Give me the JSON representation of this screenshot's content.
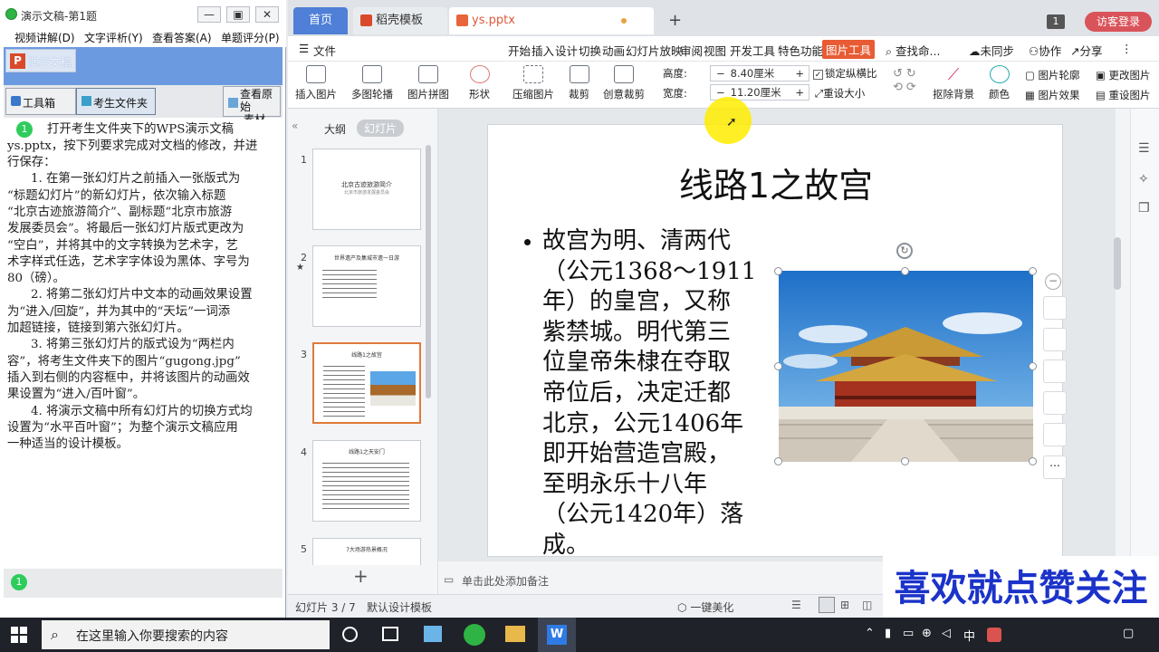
{
  "exam": {
    "title": "演示文稿-第1题",
    "menu": [
      "视频讲解(D)",
      "文字评析(Y)",
      "查看答案(A)",
      "单题评分(P)"
    ],
    "brand_label": "演示文稿",
    "brand_logo": "P",
    "tools": {
      "toolbox": "工具箱",
      "student_folder": "考生文件夹",
      "view_original_1": "查看原始",
      "view_original_2": "素材"
    },
    "step_number": "1",
    "instructions": [
      "打开考生文件夹下的WPS演示文稿",
      "ys.pptx，按下列要求完成对文档的修改，并进",
      "行保存：",
      "1. 在第一张幻灯片之前插入一张版式为",
      "“标题幻灯片”的新幻灯片，依次输入标题",
      "“北京古迹旅游简介”、副标题“北京市旅游",
      "发展委员会”。将最后一张幻灯片版式更改为",
      "“空白”，并将其中的文字转换为艺术字，艺",
      "术字样式任选，艺术字字体设为黑体、字号为",
      "80（磅）。",
      "2. 将第二张幻灯片中文本的动画效果设置",
      "为“进入/回旋”，并为其中的“天坛”一词添",
      "加超链接，链接到第六张幻灯片。",
      "3. 将第三张幻灯片的版式设为“两栏内",
      "容”，将考生文件夹下的图片“gugong.jpg”",
      "插入到右侧的内容框中，并将该图片的动画效",
      "果设置为“进入/百叶窗”。",
      "4. 将演示文稿中所有幻灯片的切换方式均",
      "设置为“水平百叶窗”；为整个演示文稿应用",
      "一种适当的设计模板。"
    ],
    "bottom_number": "1"
  },
  "wps": {
    "tabs": {
      "home": "首页",
      "template": "稻壳模板",
      "file": "ys.pptx"
    },
    "window_count": "1",
    "visitor": "访客登录",
    "ribbon_tabs": [
      "文件",
      "开始",
      "插入",
      "设计",
      "切换",
      "动画",
      "幻灯片放映",
      "审阅",
      "视图",
      "开发工具",
      "特色功能",
      "图片工具"
    ],
    "search": "查找命...",
    "sync": "未同步",
    "collab": "协作",
    "share": "分享",
    "ribbon_buttons": [
      "插入图片",
      "多图轮播",
      "图片拼图",
      "形状",
      "压缩图片",
      "裁剪",
      "创意裁剪",
      "抠除背景",
      "颜色"
    ],
    "size": {
      "height_label": "高度:",
      "height_value": "8.40厘米",
      "width_label": "宽度:",
      "width_value": "11.20厘米",
      "lock_ratio": "锁定纵横比",
      "reset_size": "重设大小"
    },
    "right_buttons": [
      "图片轮廓",
      "更改图片",
      "图片效果",
      "重设图片"
    ],
    "panel_tabs": {
      "outline": "大纲",
      "slides": "幻灯片"
    },
    "thumbs": [
      {
        "num": "1",
        "title": "北京古迹旅游简介",
        "sub": "北京市旅游发展委员会"
      },
      {
        "num": "2",
        "title": "世界遗产及集城市遗一日游"
      },
      {
        "num": "3",
        "title": "线路1之故宫"
      },
      {
        "num": "4",
        "title": "线路1之天安门"
      },
      {
        "num": "5",
        "title": "7大场游热景概况"
      }
    ],
    "slide": {
      "title": "线路1之故宫",
      "body": [
        "故宫为明、清两代",
        "（公元1368～1911",
        "年）的皇宫，又称",
        "紫禁城。明代第三",
        "位皇帝朱棣在夺取",
        "帝位后，决定迁都",
        "北京，公元1406年",
        "即开始营造宫殿，",
        "至明永乐十八年",
        "（公元1420年）落",
        "成。"
      ]
    },
    "notes": "单击此处添加备注",
    "status": {
      "slide_pos": "幻灯片 3 / 7",
      "template": "默认设计模板",
      "beautify": "一键美化"
    }
  },
  "taskbar": {
    "search_placeholder": "在这里输入你要搜索的内容",
    "ime": "中",
    "wps_label": "W"
  },
  "overlay": {
    "promo": "喜欢就点赞关注"
  },
  "colors": {
    "accent_blue": "#4f7fd6",
    "wps_red": "#d9535a",
    "pic_tool_orange": "#e85b34",
    "exam_bar": "#6c9ae0",
    "promo_text": "#1b33c9"
  }
}
